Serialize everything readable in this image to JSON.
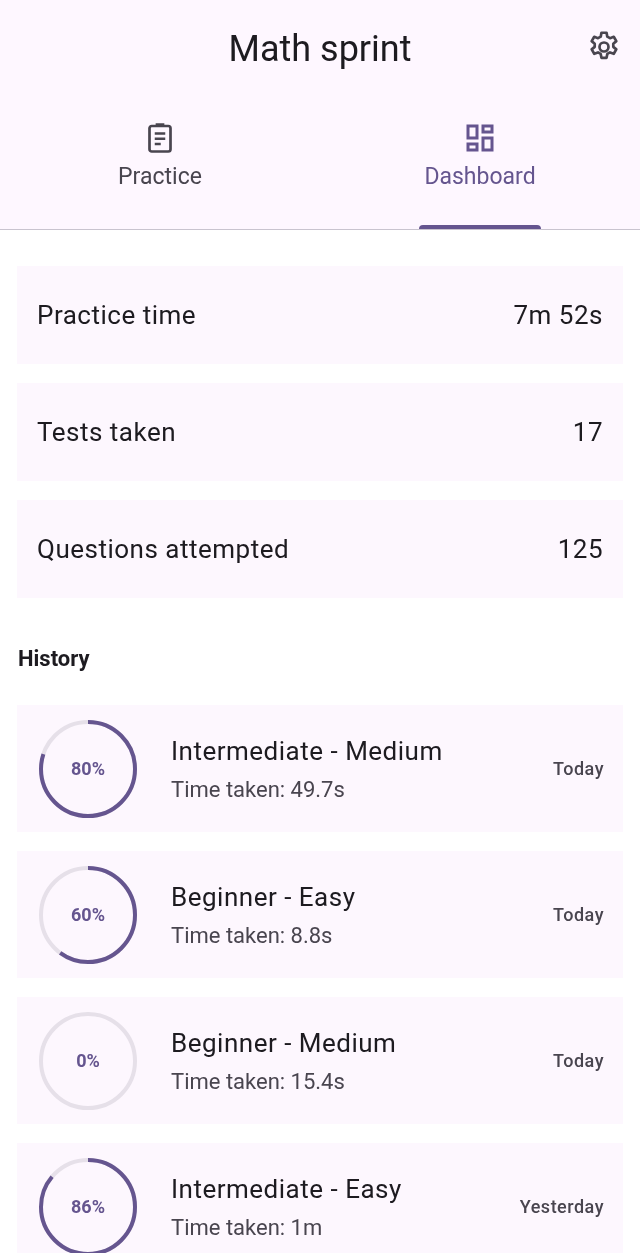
{
  "app_bar": {
    "title": "Math sprint"
  },
  "tabs": [
    {
      "label": "Practice",
      "selected": false
    },
    {
      "label": "Dashboard",
      "selected": true
    }
  ],
  "stats": [
    {
      "label": "Practice time",
      "value": "7m 52s"
    },
    {
      "label": "Tests taken",
      "value": "17"
    },
    {
      "label": "Questions attempted",
      "value": "125"
    }
  ],
  "history_title": "History",
  "history": [
    {
      "score": "80%",
      "title": "Intermediate - Medium",
      "time": "Time taken: 49.7s",
      "date": "Today"
    },
    {
      "score": "60%",
      "title": "Beginner - Easy",
      "time": "Time taken: 8.8s",
      "date": "Today"
    },
    {
      "score": "0%",
      "title": "Beginner - Medium",
      "time": "Time taken: 15.4s",
      "date": "Today"
    },
    {
      "score": "86%",
      "title": "Intermediate - Easy",
      "time": "Time taken: 1m",
      "date": "Yesterday"
    }
  ]
}
